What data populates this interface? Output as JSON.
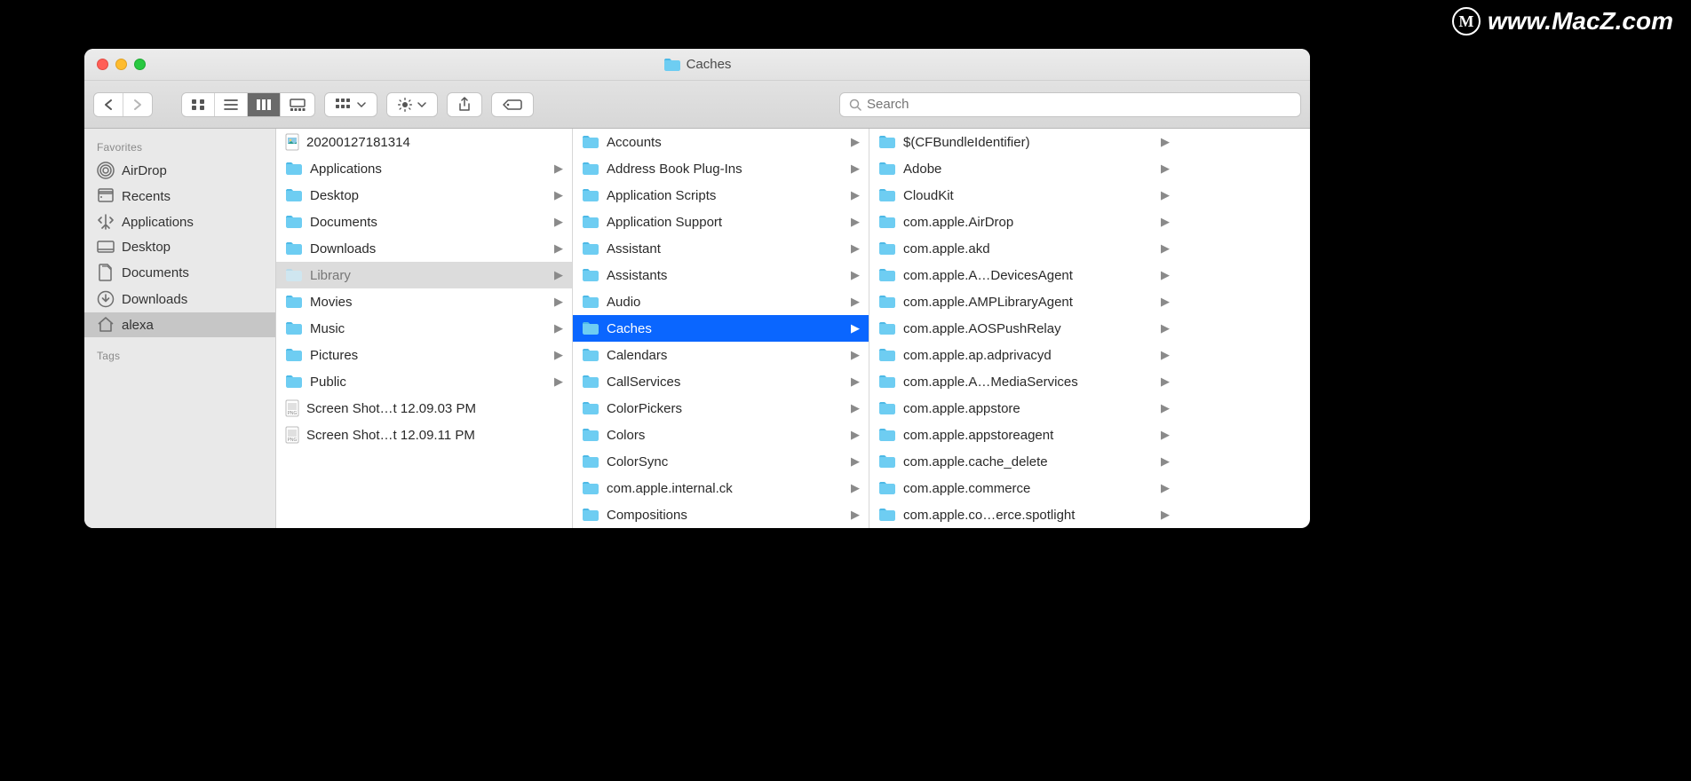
{
  "watermark": {
    "text": "www.MacZ.com",
    "badge": "M"
  },
  "window": {
    "title": "Caches"
  },
  "search": {
    "placeholder": "Search"
  },
  "sidebar": {
    "favorites_heading": "Favorites",
    "tags_heading": "Tags",
    "items": [
      {
        "label": "AirDrop",
        "icon": "airdrop"
      },
      {
        "label": "Recents",
        "icon": "recents"
      },
      {
        "label": "Applications",
        "icon": "applications"
      },
      {
        "label": "Desktop",
        "icon": "desktop"
      },
      {
        "label": "Documents",
        "icon": "documents"
      },
      {
        "label": "Downloads",
        "icon": "downloads"
      },
      {
        "label": "alexa",
        "icon": "home",
        "selected": true
      }
    ]
  },
  "columns": [
    {
      "selected_key": "Library",
      "items": [
        {
          "label": "20200127181314",
          "type": "image",
          "arrow": false
        },
        {
          "label": "Applications",
          "type": "folder",
          "arrow": true
        },
        {
          "label": "Desktop",
          "type": "folder",
          "arrow": true
        },
        {
          "label": "Documents",
          "type": "folder",
          "arrow": true
        },
        {
          "label": "Downloads",
          "type": "folder",
          "arrow": true
        },
        {
          "label": "Library",
          "type": "folder-hidden",
          "arrow": true,
          "selected": "gray"
        },
        {
          "label": "Movies",
          "type": "folder",
          "arrow": true
        },
        {
          "label": "Music",
          "type": "folder",
          "arrow": true
        },
        {
          "label": "Pictures",
          "type": "folder",
          "arrow": true
        },
        {
          "label": "Public",
          "type": "folder",
          "arrow": true
        },
        {
          "label": "Screen Shot…t 12.09.03 PM",
          "type": "png",
          "arrow": false
        },
        {
          "label": "Screen Shot…t 12.09.11 PM",
          "type": "png",
          "arrow": false
        }
      ]
    },
    {
      "selected_key": "Caches",
      "items": [
        {
          "label": "Accounts",
          "type": "folder",
          "arrow": true
        },
        {
          "label": "Address Book Plug-Ins",
          "type": "folder",
          "arrow": true
        },
        {
          "label": "Application Scripts",
          "type": "folder",
          "arrow": true
        },
        {
          "label": "Application Support",
          "type": "folder",
          "arrow": true
        },
        {
          "label": "Assistant",
          "type": "folder",
          "arrow": true
        },
        {
          "label": "Assistants",
          "type": "folder",
          "arrow": true
        },
        {
          "label": "Audio",
          "type": "folder",
          "arrow": true
        },
        {
          "label": "Caches",
          "type": "folder",
          "arrow": true,
          "selected": "blue"
        },
        {
          "label": "Calendars",
          "type": "folder",
          "arrow": true
        },
        {
          "label": "CallServices",
          "type": "folder",
          "arrow": true
        },
        {
          "label": "ColorPickers",
          "type": "folder",
          "arrow": true
        },
        {
          "label": "Colors",
          "type": "folder",
          "arrow": true
        },
        {
          "label": "ColorSync",
          "type": "folder",
          "arrow": true
        },
        {
          "label": "com.apple.internal.ck",
          "type": "folder",
          "arrow": true
        },
        {
          "label": "Compositions",
          "type": "folder",
          "arrow": true
        }
      ]
    },
    {
      "items": [
        {
          "label": "$(CFBundleIdentifier)",
          "type": "folder",
          "arrow": true
        },
        {
          "label": "Adobe",
          "type": "folder",
          "arrow": true
        },
        {
          "label": "CloudKit",
          "type": "folder",
          "arrow": true
        },
        {
          "label": "com.apple.AirDrop",
          "type": "folder",
          "arrow": true
        },
        {
          "label": "com.apple.akd",
          "type": "folder",
          "arrow": true
        },
        {
          "label": "com.apple.A…DevicesAgent",
          "type": "folder",
          "arrow": true
        },
        {
          "label": "com.apple.AMPLibraryAgent",
          "type": "folder",
          "arrow": true
        },
        {
          "label": "com.apple.AOSPushRelay",
          "type": "folder",
          "arrow": true
        },
        {
          "label": "com.apple.ap.adprivacyd",
          "type": "folder",
          "arrow": true
        },
        {
          "label": "com.apple.A…MediaServices",
          "type": "folder",
          "arrow": true
        },
        {
          "label": "com.apple.appstore",
          "type": "folder",
          "arrow": true
        },
        {
          "label": "com.apple.appstoreagent",
          "type": "folder",
          "arrow": true
        },
        {
          "label": "com.apple.cache_delete",
          "type": "folder",
          "arrow": true
        },
        {
          "label": "com.apple.commerce",
          "type": "folder",
          "arrow": true
        },
        {
          "label": "com.apple.co…erce.spotlight",
          "type": "folder",
          "arrow": true
        }
      ]
    }
  ]
}
